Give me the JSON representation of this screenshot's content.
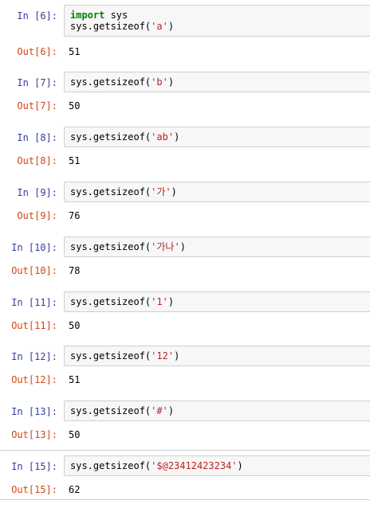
{
  "cells": [
    {
      "in_prompt": "In [6]:",
      "out_prompt": "Out[6]:",
      "code_lines": [
        [
          {
            "t": "import",
            "c": "kw"
          },
          {
            "t": " sys",
            "c": ""
          }
        ],
        [
          {
            "t": "sys.getsizeof(",
            "c": ""
          },
          {
            "t": "'a'",
            "c": "str"
          },
          {
            "t": ")",
            "c": ""
          }
        ]
      ],
      "output": "51"
    },
    {
      "in_prompt": "In [7]:",
      "out_prompt": "Out[7]:",
      "code_lines": [
        [
          {
            "t": "sys.getsizeof(",
            "c": ""
          },
          {
            "t": "'b'",
            "c": "str"
          },
          {
            "t": ")",
            "c": ""
          }
        ]
      ],
      "output": "50"
    },
    {
      "in_prompt": "In [8]:",
      "out_prompt": "Out[8]:",
      "code_lines": [
        [
          {
            "t": "sys.getsizeof(",
            "c": ""
          },
          {
            "t": "'ab'",
            "c": "str"
          },
          {
            "t": ")",
            "c": ""
          }
        ]
      ],
      "output": "51"
    },
    {
      "in_prompt": "In [9]:",
      "out_prompt": "Out[9]:",
      "code_lines": [
        [
          {
            "t": "sys.getsizeof(",
            "c": ""
          },
          {
            "t": "'가'",
            "c": "str"
          },
          {
            "t": ")",
            "c": ""
          }
        ]
      ],
      "output": "76"
    },
    {
      "in_prompt": "In [10]:",
      "out_prompt": "Out[10]:",
      "code_lines": [
        [
          {
            "t": "sys.getsizeof(",
            "c": ""
          },
          {
            "t": "'가나'",
            "c": "str"
          },
          {
            "t": ")",
            "c": ""
          }
        ]
      ],
      "output": "78"
    },
    {
      "in_prompt": "In [11]:",
      "out_prompt": "Out[11]:",
      "code_lines": [
        [
          {
            "t": "sys.getsizeof(",
            "c": ""
          },
          {
            "t": "'1'",
            "c": "str"
          },
          {
            "t": ")",
            "c": ""
          }
        ]
      ],
      "output": "50"
    },
    {
      "in_prompt": "In [12]:",
      "out_prompt": "Out[12]:",
      "code_lines": [
        [
          {
            "t": "sys.getsizeof(",
            "c": ""
          },
          {
            "t": "'12'",
            "c": "str"
          },
          {
            "t": ")",
            "c": ""
          }
        ]
      ],
      "output": "51"
    },
    {
      "in_prompt": "In [13]:",
      "out_prompt": "Out[13]:",
      "code_lines": [
        [
          {
            "t": "sys.getsizeof(",
            "c": ""
          },
          {
            "t": "'#'",
            "c": "str"
          },
          {
            "t": ")",
            "c": ""
          }
        ]
      ],
      "output": "50"
    },
    {
      "in_prompt": "In [15]:",
      "out_prompt": "Out[15]:",
      "code_lines": [
        [
          {
            "t": "sys.getsizeof(",
            "c": ""
          },
          {
            "t": "'$@23412423234'",
            "c": "str"
          },
          {
            "t": ")",
            "c": ""
          }
        ]
      ],
      "output": "62",
      "selected": true
    }
  ]
}
